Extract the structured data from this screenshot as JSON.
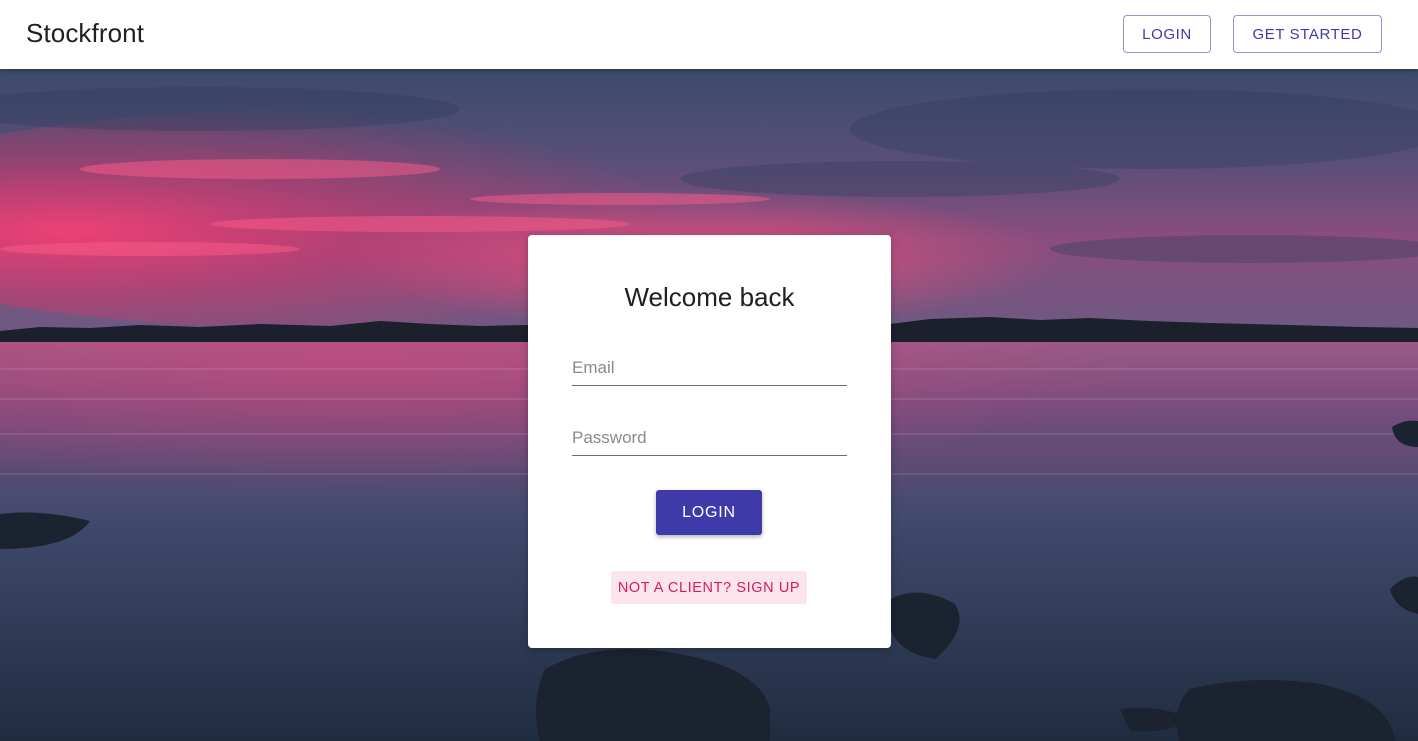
{
  "header": {
    "brand": "Stockfront",
    "login_label": "LOGIN",
    "get_started_label": "GET STARTED"
  },
  "login_card": {
    "title": "Welcome back",
    "email_placeholder": "Email",
    "email_value": "",
    "password_placeholder": "Password",
    "password_value": "",
    "login_label": "LOGIN",
    "signup_label": "NOT A CLIENT? SIGN UP"
  },
  "colors": {
    "primary": "#3f3aaa",
    "secondary": "#d81b60",
    "secondary_tint": "#fce4ec",
    "appbar_bg": "#ffffff",
    "card_bg": "#ffffff"
  },
  "background": {
    "subject": "sunset over lake with rocks"
  }
}
